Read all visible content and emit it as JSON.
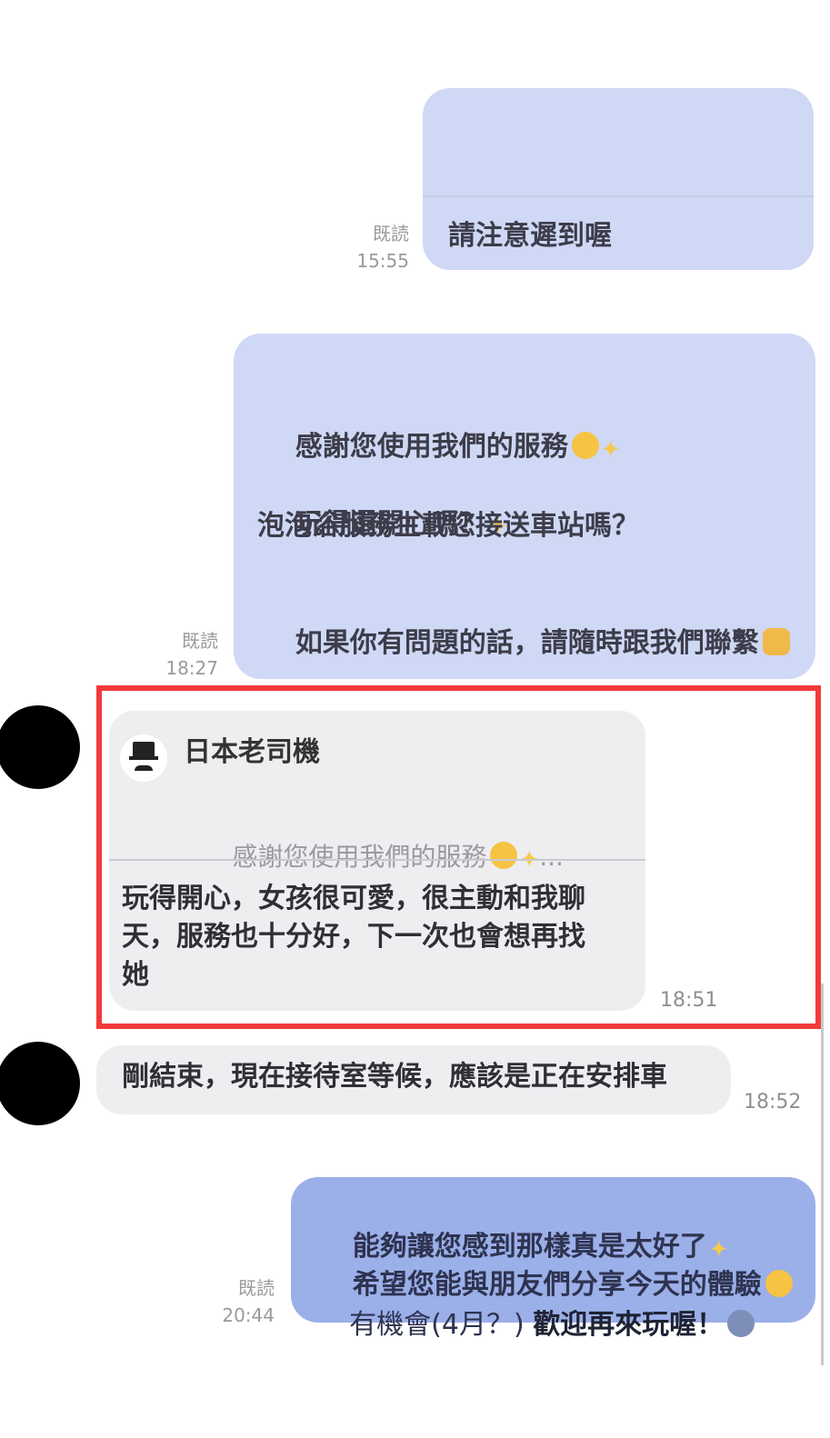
{
  "messages": {
    "m1": {
      "read": "既読",
      "time": "15:55",
      "text": "請注意遲到喔"
    },
    "m2": {
      "read": "既読",
      "time": "18:27",
      "line1": "感謝您使用我們的服務",
      "line2": "玩得還開心嗎？",
      "line3": "泡泡浴服務生載您接送車站嗎？",
      "line4": "如果你有問題的話，請隨時跟我們聯繫"
    },
    "m3": {
      "reply_to_name": "日本老司機",
      "reply_to_text": "感謝您使用我們的服務",
      "reply_to_ellipsis": "...",
      "line1": "玩得開心，女孩很可愛，很主動和我聊",
      "line2": "天，服務也十分好，下一次也會想再找",
      "line3": "她",
      "time": "18:51"
    },
    "m4": {
      "text": "剛結束，現在接待室等候，應該是正在安排車",
      "time": "18:52"
    },
    "m5": {
      "read": "既読",
      "time": "20:44",
      "line1": "能夠讓您感到那樣真是太好了",
      "line2": "希望您能與朋友們分享今天的體驗",
      "line3_normal": "有機會(4月？) ",
      "line3_bold": "歡迎再來玩喔！"
    }
  },
  "colors": {
    "bubble_out": "#cfd8f5",
    "bubble_out_highlight": "#9bafe9",
    "bubble_in": "#eeeef1",
    "highlight_border": "#f23a3a"
  },
  "icons": [
    "smile-emoji-icon",
    "sparkles-icon",
    "thumbs-up-icon",
    "sunglasses-emoji-icon",
    "person-gesture-icon",
    "top-hat-mustache-icon"
  ]
}
